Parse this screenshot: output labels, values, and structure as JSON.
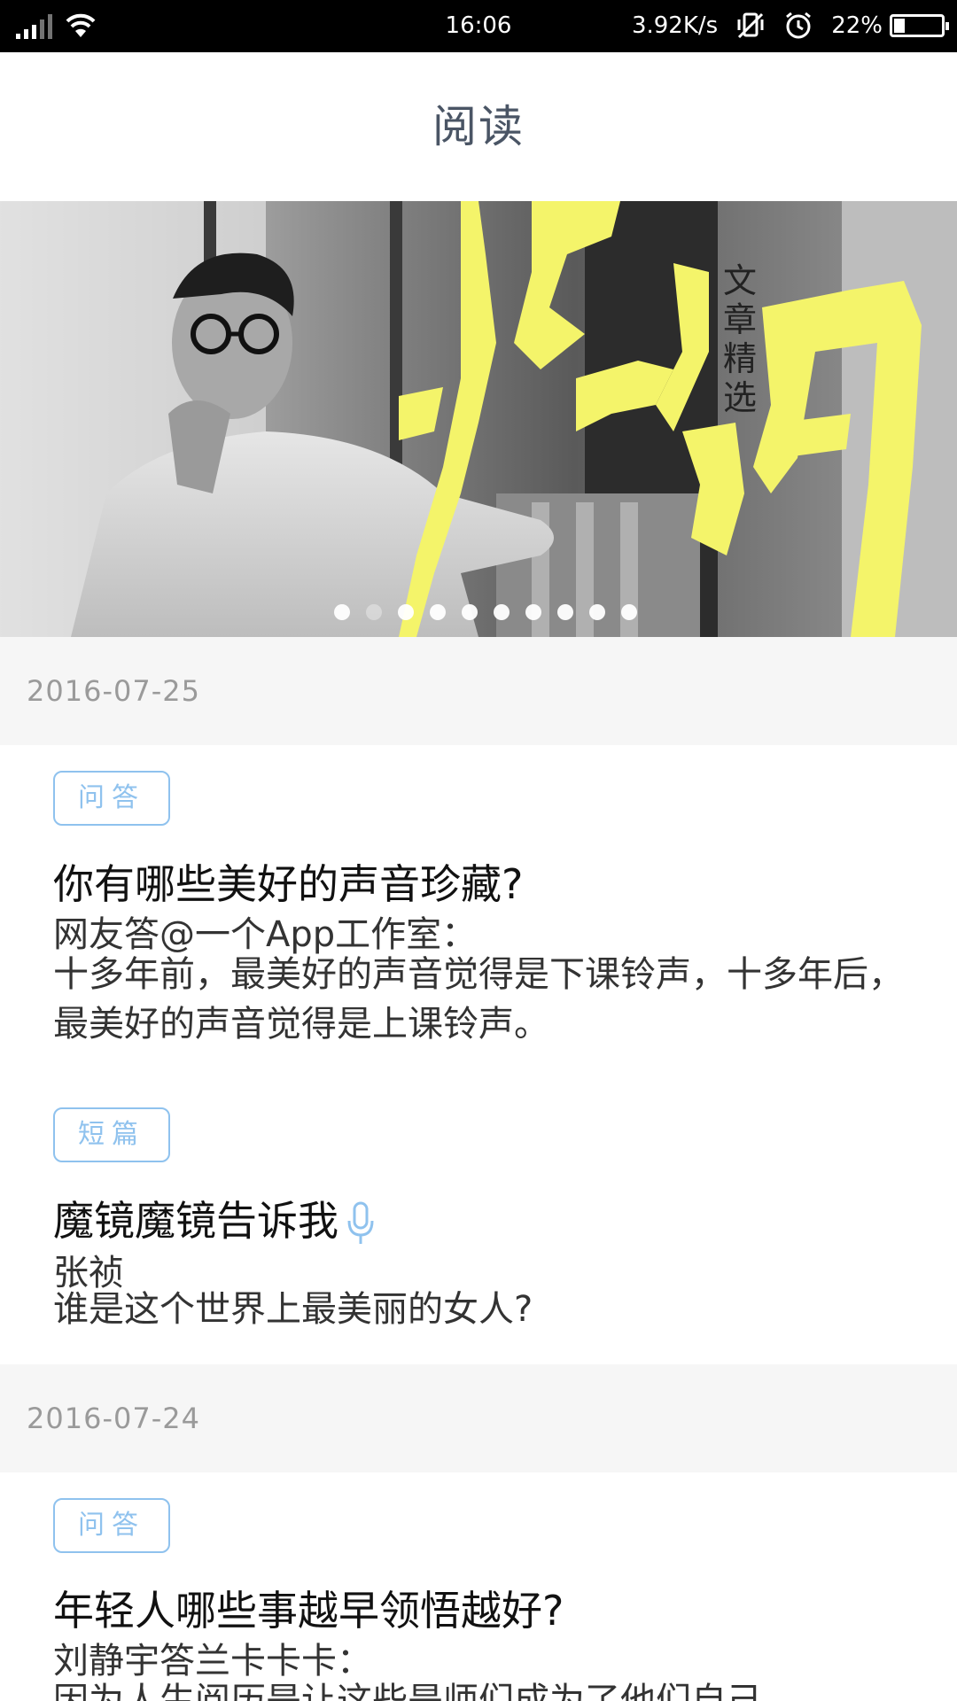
{
  "status_bar": {
    "time": "16:06",
    "network_speed": "3.92K/s",
    "battery_percent": "22%",
    "battery_level": 0.22,
    "icons": [
      "signal-icon",
      "wifi-icon",
      "vibrate-icon",
      "alarm-icon",
      "battery-icon"
    ]
  },
  "header": {
    "title": "阅读"
  },
  "banner": {
    "vertical_caption": "文章精选",
    "page_count": 10,
    "active_index": 1
  },
  "sections": [
    {
      "date": "2016-07-25",
      "articles": [
        {
          "tag": "问答",
          "title": "你有哪些美好的声音珍藏?",
          "author": "网友答@一个App工作室：",
          "summary": "十多年前，最美好的声音觉得是下课铃声，十多年后，最美好的声音觉得是上课铃声。"
        },
        {
          "tag": "短篇",
          "title": "魔镜魔镜告诉我",
          "has_audio": true,
          "author": "张祯",
          "summary": "谁是这个世界上最美丽的女人?"
        }
      ]
    },
    {
      "date": "2016-07-24",
      "articles": [
        {
          "tag": "问答",
          "title": "年轻人哪些事越早领悟越好?",
          "author": "刘静宇答兰卡卡卡：",
          "summary": "因为人生阅历是让这些是师们成为了他们自己"
        }
      ]
    }
  ],
  "colors": {
    "tag_blue": "#8fc2ee",
    "banner_yellow": "#f4f46a",
    "date_bg": "#f6f6f6",
    "header_text": "#4a5565"
  }
}
